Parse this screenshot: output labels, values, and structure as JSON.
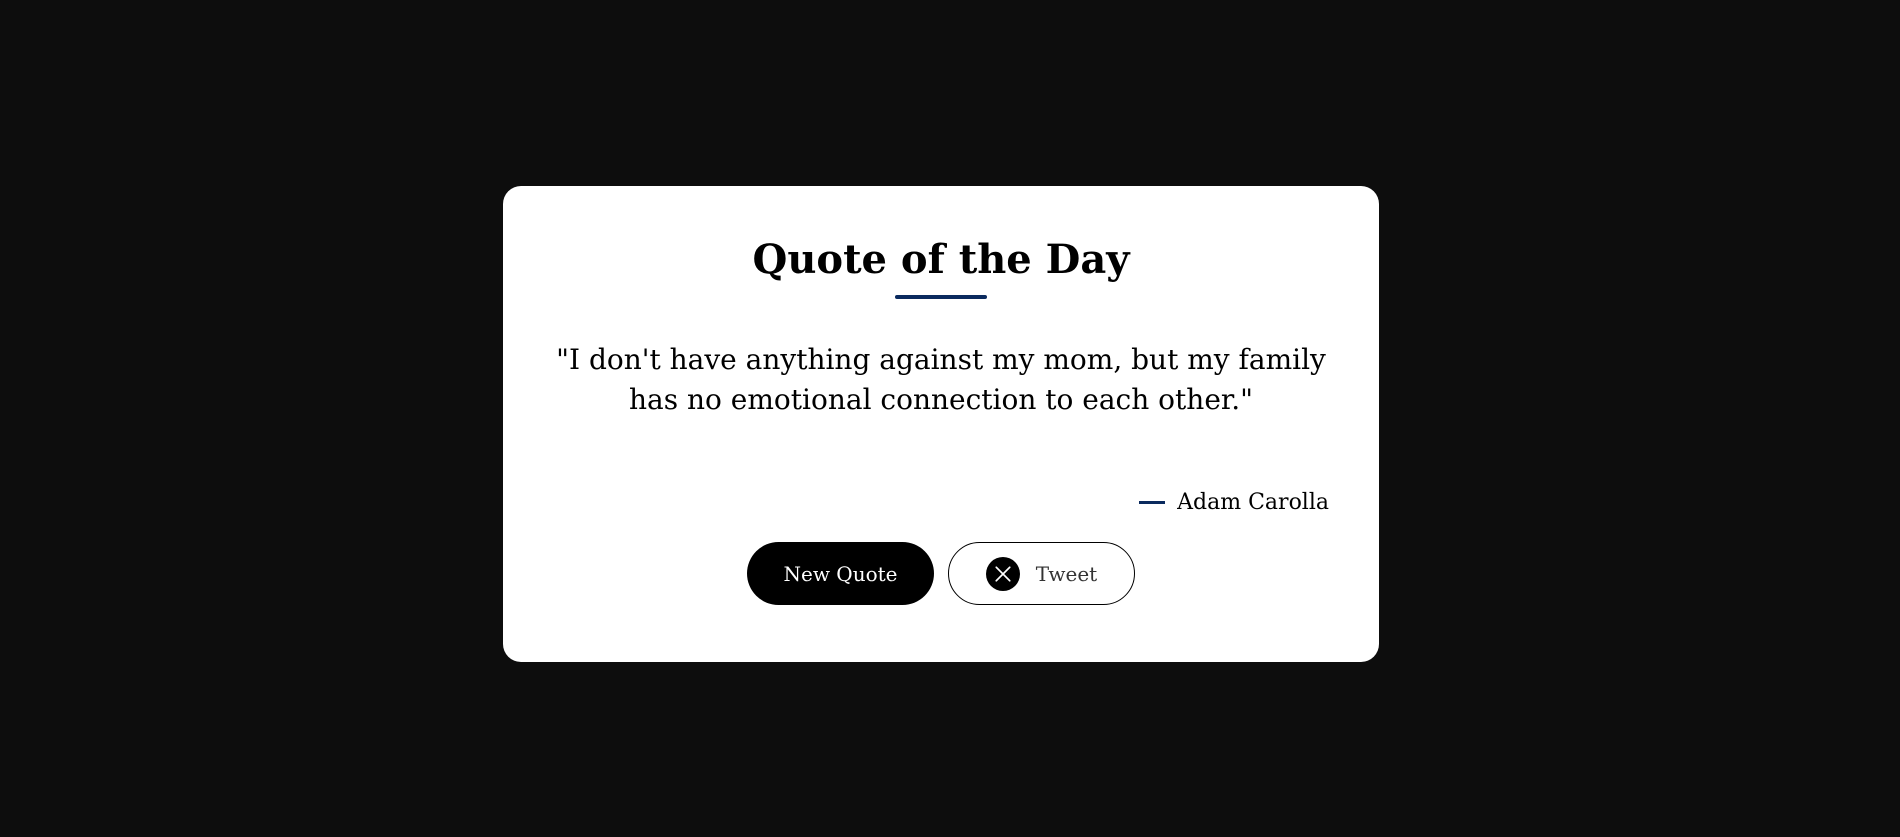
{
  "card": {
    "title": "Quote of the Day",
    "quote": "\"I don't have anything against my mom, but my family has no emotional connection to each other.\"",
    "author": "Adam Carolla"
  },
  "buttons": {
    "new_quote_label": "New Quote",
    "tweet_label": "Tweet"
  },
  "icons": {
    "tweet_icon": "x-logo-icon"
  },
  "colors": {
    "background": "#0d0d0d",
    "card": "#ffffff",
    "accent": "#0a2a5e",
    "button_primary": "#000000"
  }
}
